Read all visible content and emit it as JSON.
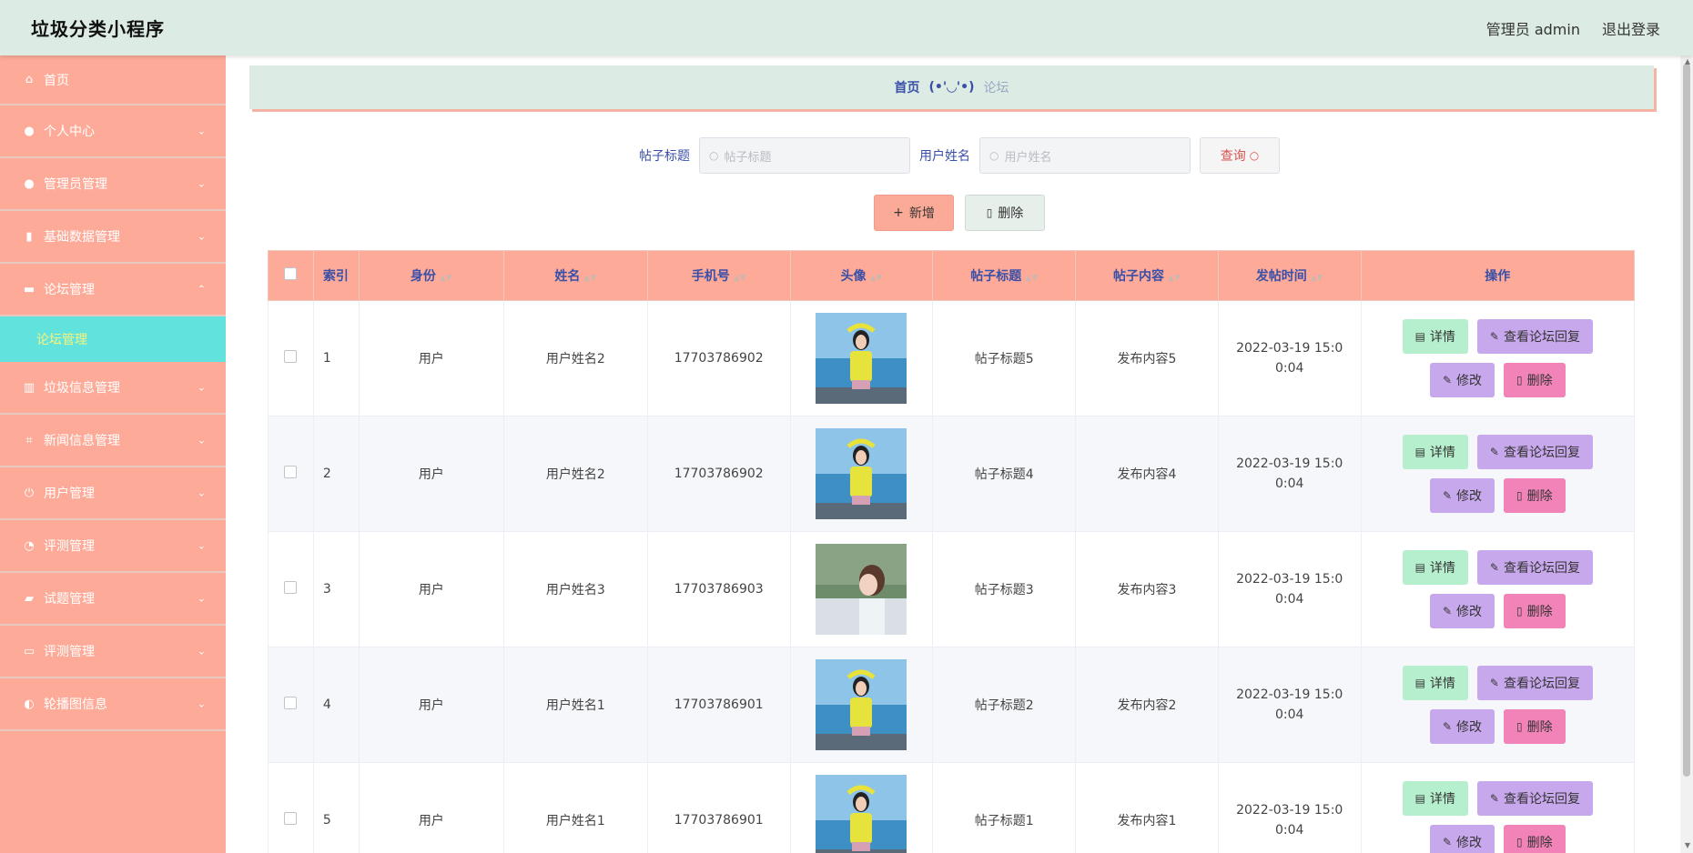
{
  "header": {
    "title": "垃圾分类小程序",
    "user": "管理员 admin",
    "logout": "退出登录"
  },
  "sidebar": {
    "items": [
      {
        "label": "首页",
        "icon": "home-icon",
        "glyph": "⌂",
        "chevron": ""
      },
      {
        "label": "个人中心",
        "icon": "user-icon",
        "glyph": "●",
        "chevron": "⌄"
      },
      {
        "label": "管理员管理",
        "icon": "user-icon",
        "glyph": "●",
        "chevron": "⌄"
      },
      {
        "label": "基础数据管理",
        "icon": "microphone-icon",
        "glyph": "▮",
        "chevron": "⌄"
      },
      {
        "label": "论坛管理",
        "icon": "chat-icon",
        "glyph": "▬",
        "chevron": "⌃"
      },
      {
        "label": "垃圾信息管理",
        "icon": "bar-chart-icon",
        "glyph": "▥",
        "chevron": "⌄"
      },
      {
        "label": "新闻信息管理",
        "icon": "crop-icon",
        "glyph": "⌗",
        "chevron": "⌄"
      },
      {
        "label": "用户管理",
        "icon": "power-icon",
        "glyph": "⏻",
        "chevron": "⌄"
      },
      {
        "label": "评测管理",
        "icon": "compass-icon",
        "glyph": "◔",
        "chevron": "⌄"
      },
      {
        "label": "试题管理",
        "icon": "briefcase-icon",
        "glyph": "▰",
        "chevron": "⌄"
      },
      {
        "label": "评测管理",
        "icon": "monitor-icon",
        "glyph": "▭",
        "chevron": "⌄"
      },
      {
        "label": "轮播图信息",
        "icon": "dashboard-icon",
        "glyph": "◐",
        "chevron": "⌄"
      }
    ],
    "submenu": {
      "label": "论坛管理"
    }
  },
  "breadcrumb": {
    "home": "首页",
    "sep": "(•'◡'•)",
    "current": "论坛"
  },
  "search": {
    "title_label": "帖子标题",
    "title_placeholder": "帖子标题",
    "name_label": "用户姓名",
    "name_placeholder": "用户姓名",
    "query_button": "查询"
  },
  "actions": {
    "add": "新增",
    "delete": "删除"
  },
  "table": {
    "headers": [
      "索引",
      "身份",
      "姓名",
      "手机号",
      "头像",
      "帖子标题",
      "帖子内容",
      "发帖时间",
      "操作"
    ],
    "rows": [
      {
        "index": "1",
        "identity": "用户",
        "name": "用户姓名2",
        "phone": "17703786902",
        "avatar": "yellow",
        "title": "帖子标题5",
        "content": "发布内容5",
        "time": "2022-03-19 15:00:04"
      },
      {
        "index": "2",
        "identity": "用户",
        "name": "用户姓名2",
        "phone": "17703786902",
        "avatar": "yellow",
        "title": "帖子标题4",
        "content": "发布内容4",
        "time": "2022-03-19 15:00:04"
      },
      {
        "index": "3",
        "identity": "用户",
        "name": "用户姓名3",
        "phone": "17703786903",
        "avatar": "profile",
        "title": "帖子标题3",
        "content": "发布内容3",
        "time": "2022-03-19 15:00:04"
      },
      {
        "index": "4",
        "identity": "用户",
        "name": "用户姓名1",
        "phone": "17703786901",
        "avatar": "yellow",
        "title": "帖子标题2",
        "content": "发布内容2",
        "time": "2022-03-19 15:00:04"
      },
      {
        "index": "5",
        "identity": "用户",
        "name": "用户姓名1",
        "phone": "17703786901",
        "avatar": "yellow",
        "title": "帖子标题1",
        "content": "发布内容1",
        "time": "2022-03-19 15:00:04"
      }
    ],
    "ops": {
      "detail": "详情",
      "view_replies": "查看论坛回复",
      "edit": "修改",
      "remove": "删除"
    }
  },
  "colors": {
    "header_bg": "#dcebe3",
    "sidebar_bg": "#fdab98",
    "submenu_bg": "#62e2dc",
    "accent_text": "#3a4fa8",
    "detail_btn": "#b6efce",
    "purple_btn": "#c8a8ec",
    "pink_btn": "#f283b8"
  }
}
